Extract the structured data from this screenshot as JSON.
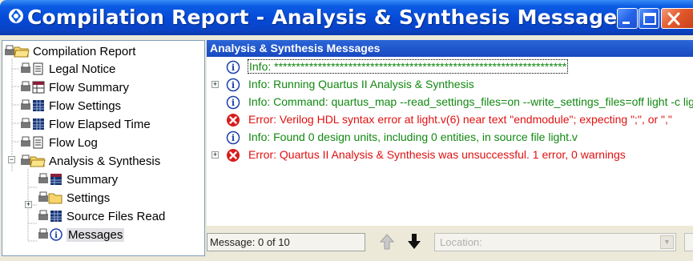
{
  "window": {
    "title": "Compilation Report - Analysis & Synthesis Messages",
    "colors": {
      "titlebar": "#0549d6",
      "close": "#e35a2c",
      "info_text": "#118811",
      "error_text": "#e01010"
    }
  },
  "tree": {
    "items": [
      {
        "label": "Compilation Report",
        "icon": "folder-open-icon",
        "selected": false
      },
      {
        "label": "Legal Notice",
        "icon": "document-icon",
        "selected": false
      },
      {
        "label": "Flow Summary",
        "icon": "table-summary-icon",
        "selected": false
      },
      {
        "label": "Flow Settings",
        "icon": "table-icon",
        "selected": false
      },
      {
        "label": "Flow Elapsed Time",
        "icon": "table-icon",
        "selected": false
      },
      {
        "label": "Flow Log",
        "icon": "document-icon",
        "selected": false
      },
      {
        "label": "Analysis & Synthesis",
        "icon": "folder-open-icon",
        "selected": false
      },
      {
        "label": "Summary",
        "icon": "table-summary-icon",
        "selected": false
      },
      {
        "label": "Settings",
        "icon": "folder-icon",
        "selected": false
      },
      {
        "label": "Source Files Read",
        "icon": "table-icon",
        "selected": false
      },
      {
        "label": "Messages",
        "icon": "info-icon",
        "selected": true
      }
    ]
  },
  "messages": {
    "header": "Analysis & Synthesis Messages",
    "rows": [
      {
        "type": "info",
        "expandable": false,
        "text": "Info: *******************************************************************"
      },
      {
        "type": "info",
        "expandable": true,
        "text": "Info: Running Quartus II Analysis & Synthesis"
      },
      {
        "type": "info",
        "expandable": false,
        "text": "Info: Command: quartus_map --read_settings_files=on --write_settings_files=off light -c light"
      },
      {
        "type": "error",
        "expandable": false,
        "text": "Error: Verilog HDL syntax error at light.v(6) near text \"endmodule\";  expecting \";\", or \",\""
      },
      {
        "type": "info",
        "expandable": false,
        "text": "Info: Found 0 design units, including 0 entities, in source file light.v"
      },
      {
        "type": "error",
        "expandable": true,
        "text": "Error: Quartus II Analysis & Synthesis was unsuccessful. 1 error, 0 warnings"
      }
    ]
  },
  "footer": {
    "counter": "Message: 0 of 10",
    "location_placeholder": "Location:"
  }
}
